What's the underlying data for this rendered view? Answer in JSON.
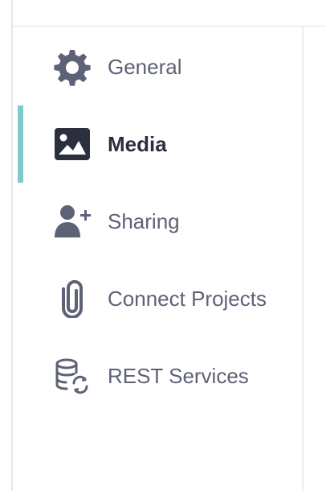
{
  "sidebar": {
    "items": [
      {
        "label": "General",
        "icon": "gear-icon",
        "active": false
      },
      {
        "label": "Media",
        "icon": "image-icon",
        "active": true
      },
      {
        "label": "Sharing",
        "icon": "add-user-icon",
        "active": false
      },
      {
        "label": "Connect Projects",
        "icon": "paperclip-icon",
        "active": false
      },
      {
        "label": "REST Services",
        "icon": "database-sync-icon",
        "active": false
      }
    ]
  },
  "colors": {
    "active_indicator": "#7ecbcc",
    "icon_default": "#5e6276",
    "icon_active": "#2b2f3e",
    "text_default": "#5e6276",
    "text_active": "#2b2f3e"
  }
}
